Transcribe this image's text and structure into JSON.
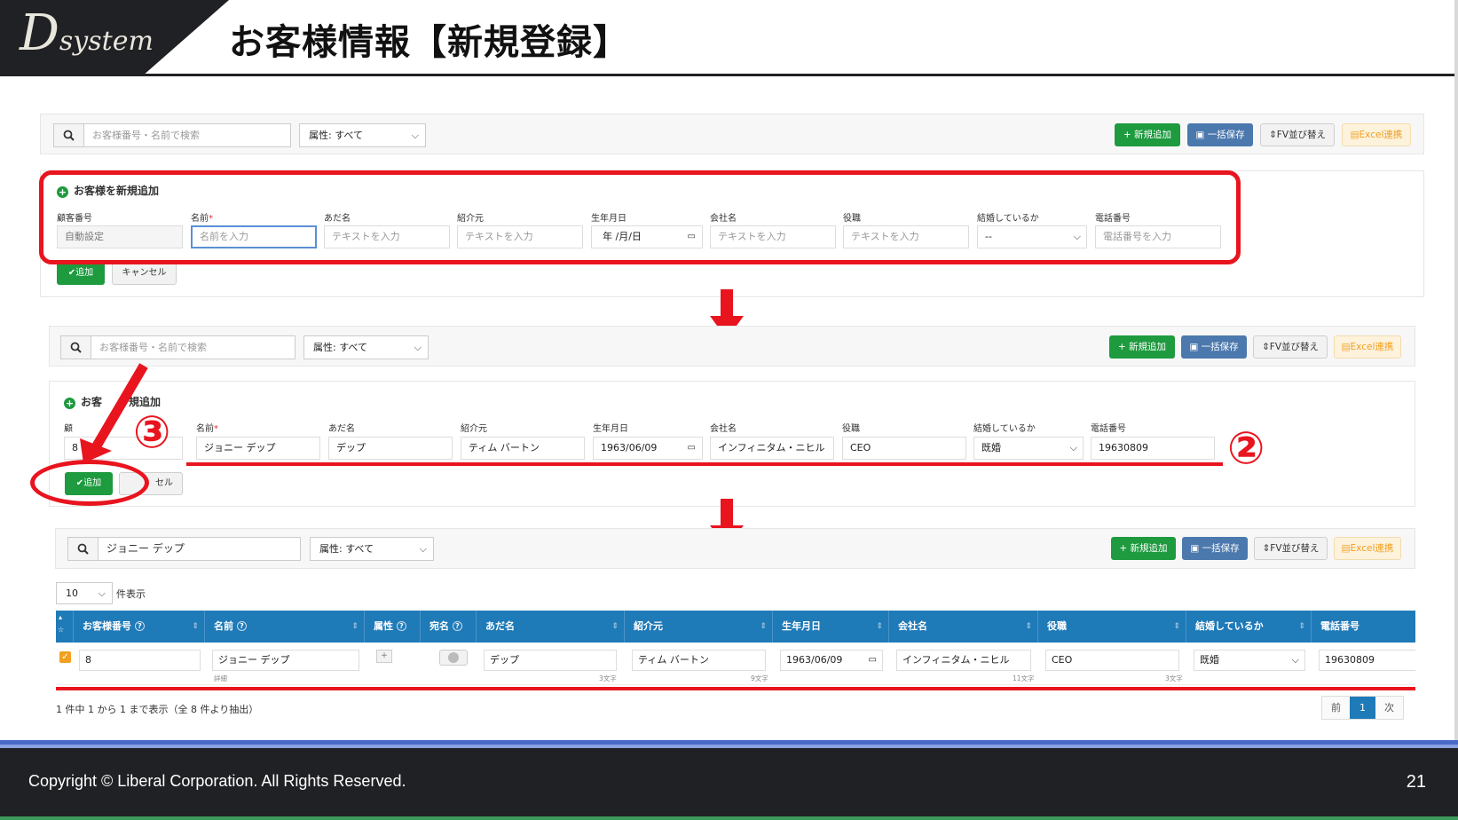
{
  "slide": {
    "logo_big": "D",
    "logo_small": "system",
    "title": "お客様情報【新規登録】",
    "copyright": "Copyright ©  Liberal Corporation. All Rights Reserved.",
    "page_number": "21"
  },
  "toolbar": {
    "search_placeholder": "お客様番号・名前で検索",
    "attr_select": "属性: すべて",
    "new_button": "+ 新規追加",
    "save_button": "一括保存",
    "sort_button": "⇕FV並び替え",
    "excel_button": "Excel連携"
  },
  "form": {
    "heading": "お客様を新規追加",
    "heading_partial_left": "お客",
    "heading_partial_right": "規追加",
    "labels": {
      "id": "顧客番号",
      "id_partial": "顧",
      "name": "名前",
      "name_req": "*",
      "nickname": "あだ名",
      "referrer": "紹介元",
      "birthday": "生年月日",
      "company": "会社名",
      "position": "役職",
      "married": "結婚しているか",
      "phone": "電話番号"
    },
    "placeholders": {
      "id": "自動設定",
      "name": "名前を入力",
      "text": "テキストを入力",
      "date": "年 /月/日",
      "married": "--",
      "phone": "電話番号を入力"
    },
    "add_button": "✔追加",
    "cancel_button": "キャンセル",
    "cancel_partial": "セル"
  },
  "filled_form": {
    "id": "8",
    "name": "ジョニー デップ",
    "nickname": "デップ",
    "referrer": "ティム バートン",
    "birthday": "1963/06/09",
    "company": "インフィニタム・ニヒル",
    "position": "CEO",
    "married": "既婚",
    "phone": "19630809"
  },
  "annotations": {
    "step2": "②",
    "step3": "③"
  },
  "result": {
    "search_value": "ジョニー デップ",
    "page_size": "10",
    "page_size_label": "件表示",
    "columns": [
      "お客様番号",
      "名前",
      "属性",
      "宛名",
      "あだ名",
      "紹介元",
      "生年月日",
      "会社名",
      "役職",
      "結婚しているか",
      "電話番号"
    ],
    "row": {
      "id": "8",
      "name": "ジョニー デップ",
      "name_sub": "詳細",
      "nickname": "デップ",
      "nickname_count": "3文字",
      "referrer": "ティム バートン",
      "referrer_count": "9文字",
      "birthday": "1963/06/09",
      "company": "インフィニタム・ニヒル",
      "company_count": "11文字",
      "position": "CEO",
      "position_count": "3文字",
      "married": "既婚",
      "phone": "19630809"
    },
    "summary": "1 件中 1 から 1 まで表示（全 8 件より抽出）",
    "pager_prev": "前",
    "pager_current": "1",
    "pager_next": "次"
  },
  "colors": {
    "accent_red": "#e8141e",
    "table_header": "#1f7ab8",
    "green_button": "#1e9a3f",
    "blue_button": "#4b78ad"
  }
}
